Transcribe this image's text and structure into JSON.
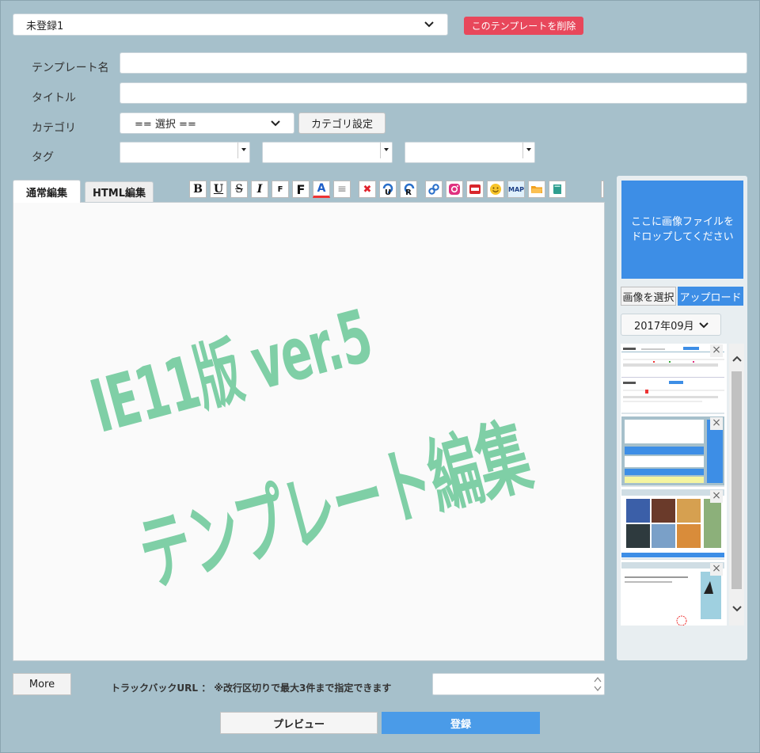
{
  "template_select": {
    "value": "未登録1"
  },
  "delete_button": "このテンプレートを削除",
  "form": {
    "template_name_label": "テンプレート名",
    "title_label": "タイトル",
    "category_label": "カテゴリ",
    "category_value": "== 選択 ==",
    "category_settings_button": "カテゴリ設定",
    "tag_label": "タグ"
  },
  "tabs": {
    "normal": "通常編集",
    "html": "HTML編集"
  },
  "toolbar": {
    "bold": "B",
    "underline": "U",
    "strike": "S",
    "italic": "I",
    "font_small": "F",
    "font_large": "F",
    "color": "A",
    "align": "≡",
    "clear": "✖",
    "undo": "U",
    "redo": "R",
    "map": "MAP"
  },
  "editor": {
    "watermark_line1": "IE11版 ver.5",
    "watermark_line2": "テンプレート編集"
  },
  "right_panel": {
    "dropzone_text": "ここに画像ファイルをドロップしてください",
    "select_image_button": "画像を選択",
    "upload_button": "アップロード",
    "month_value": "2017年09月"
  },
  "bottom": {
    "more_button": "More",
    "trackback_label": "トラックバックURL ： ※改行区切りで最大3件まで指定できます",
    "preview_button": "プレビュー",
    "register_button": "登録"
  },
  "colors": {
    "page_bg": "#a6c0cb",
    "delete_red": "#e8475b",
    "accent_blue": "#3d8ee6",
    "watermark_green": "#7fcfa6"
  }
}
